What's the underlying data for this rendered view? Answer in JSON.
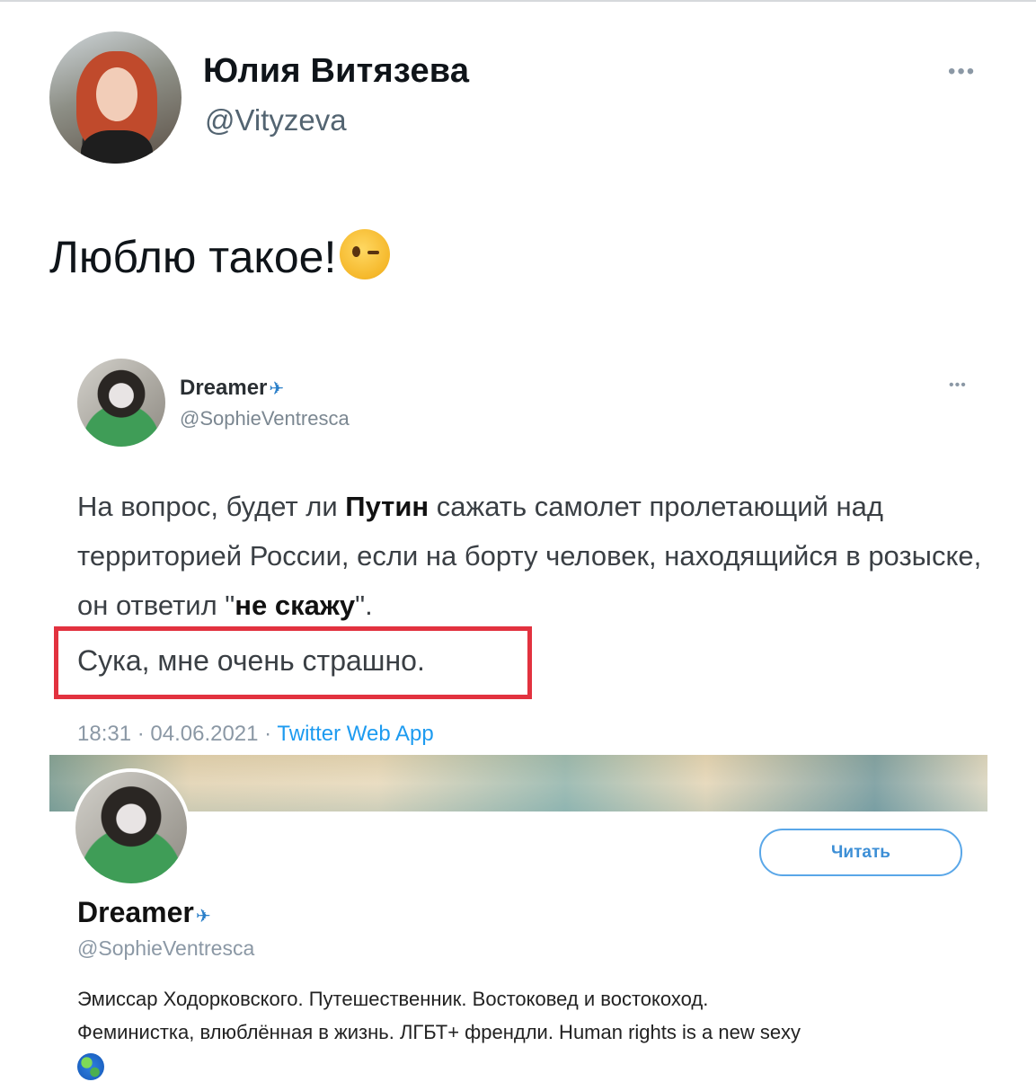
{
  "tweet": {
    "author_name": "Юлия Витязева",
    "author_handle": "@Vityzeva",
    "more_icon": "more-dots-icon",
    "text": "Люблю такое!",
    "emoji": "winking-face-icon"
  },
  "embedded_tweet": {
    "author_name": "Dreamer",
    "author_handle": "@SophieVentresca",
    "body_part1": "На вопрос, будет ли ",
    "body_bold1": "Путин",
    "body_part2": " сажать самолет пролетающий над территорией России, если на борту человек, находящийся в розыске, он ответил \"",
    "body_bold2": "не скажу",
    "body_part3": "\".",
    "highlighted_line": "Сука, мне очень страшно.",
    "highlight_color": "#e2323f",
    "time": "18:31 · 04.06.2021 · ",
    "app": "Twitter Web App"
  },
  "profile": {
    "follow_label": "Читать",
    "name": "Dreamer",
    "handle": "@SophieVentresca",
    "bio_line1": "Эмиссар Ходорковского. Путешественник. Востоковед и востокоход.",
    "bio_line2": "Феминистка, влюблённая в жизнь. ЛГБТ+ френдли. Human rights is a new sexy",
    "bio_emoji": "globe-icon"
  },
  "colors": {
    "accent": "#1d9bf0",
    "follow_border": "#5aa7e8",
    "secondary_text": "#536471"
  }
}
